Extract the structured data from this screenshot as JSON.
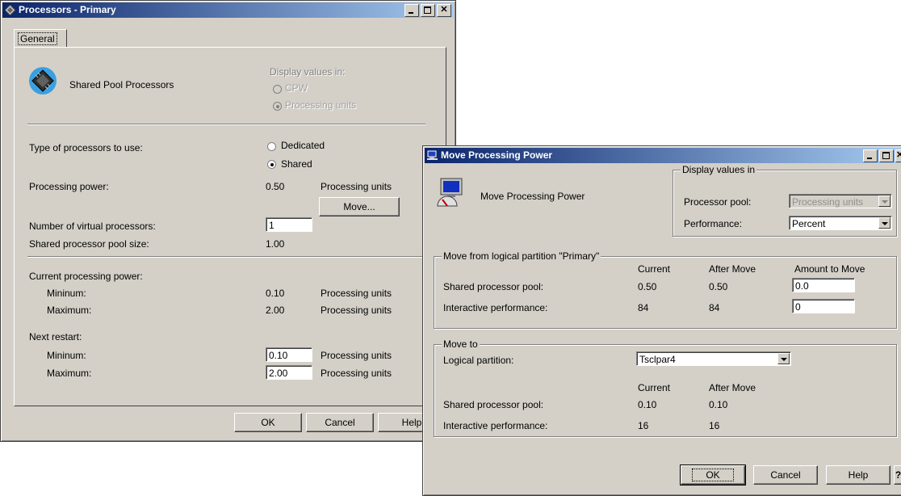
{
  "proc_window": {
    "title": "Processors - Primary",
    "tab": "General",
    "header_label": "Shared Pool Processors",
    "display_values_label": "Display values in:",
    "display_options": [
      "CPW",
      "Processing units"
    ],
    "type_label": "Type of processors to use:",
    "type_options": [
      "Dedicated",
      "Shared"
    ],
    "power_label": "Processing power:",
    "power_value": "0.50",
    "power_unit": "Processing units",
    "move_button": "Move...",
    "virtual_label": "Number of virtual processors:",
    "virtual_value": "1",
    "pool_size_label": "Shared processor pool size:",
    "pool_size_value": "1.00",
    "current_label": "Current processing power:",
    "current_min_label": "Mininum:",
    "current_min_value": "0.10",
    "current_max_label": "Maximum:",
    "current_max_value": "2.00",
    "restart_label": "Next restart:",
    "restart_min_label": "Mininum:",
    "restart_min_value": "0.10",
    "restart_max_label": "Maximum:",
    "restart_max_value": "2.00",
    "units": "Processing units",
    "buttons": {
      "ok": "OK",
      "cancel": "Cancel",
      "help": "Help"
    }
  },
  "move_window": {
    "title": "Move Processing Power",
    "header_label": "Move Processing Power",
    "display_group": "Display values in",
    "pool_label": "Processor pool:",
    "pool_value": "Processing units",
    "perf_label": "Performance:",
    "perf_value": "Percent",
    "from_group": "Move from logical partition \"Primary\"",
    "col_current": "Current",
    "col_after": "After Move",
    "col_amount": "Amount to Move",
    "from_pool_label": "Shared processor pool:",
    "from_pool_current": "0.50",
    "from_pool_after": "0.50",
    "from_pool_amount": "0.0",
    "from_perf_label": "Interactive performance:",
    "from_perf_current": "84",
    "from_perf_after": "84",
    "from_perf_amount": "0",
    "to_group": "Move to",
    "lp_label": "Logical partition:",
    "lp_value": "Tsclpar4",
    "to_col_current": "Current",
    "to_col_after": "After Move",
    "to_pool_label": "Shared processor pool:",
    "to_pool_current": "0.10",
    "to_pool_after": "0.10",
    "to_perf_label": "Interactive performance:",
    "to_perf_current": "16",
    "to_perf_after": "16",
    "buttons": {
      "ok": "OK",
      "cancel": "Cancel",
      "help": "Help",
      "whats_this": "?"
    }
  }
}
